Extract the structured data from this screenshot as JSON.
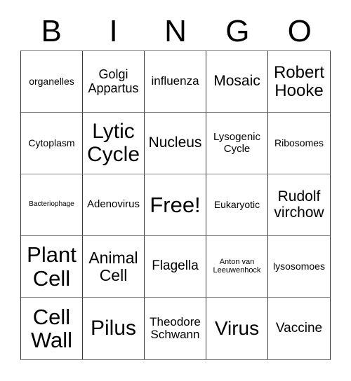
{
  "card": {
    "title": "BINGO",
    "header_letters": [
      "B",
      "I",
      "N",
      "G",
      "O"
    ],
    "grid_size": "5x5",
    "free_space_index": 12,
    "colors": {
      "background": "#ffffff",
      "text": "#000000",
      "grid_line": "#3a3a3a",
      "grid_line_light": "#808080"
    },
    "cells": [
      {
        "text": "organelles",
        "font_size": "14px"
      },
      {
        "text": "Golgi\nAppartus",
        "font_size": "18px"
      },
      {
        "text": "influenza",
        "font_size": "17px"
      },
      {
        "text": "Mosaic",
        "font_size": "21px"
      },
      {
        "text": "Robert\nHooke",
        "font_size": "24px"
      },
      {
        "text": "Cytoplasm",
        "font_size": "14px"
      },
      {
        "text": "Lytic\nCycle",
        "font_size": "30px"
      },
      {
        "text": "Nucleus",
        "font_size": "21px"
      },
      {
        "text": "Lysogenic\nCycle",
        "font_size": "15px"
      },
      {
        "text": "Ribosomes",
        "font_size": "14px"
      },
      {
        "text": "Bacteriophage",
        "font_size": "10px"
      },
      {
        "text": "Adenovirus",
        "font_size": "15px"
      },
      {
        "text": "Free!",
        "font_size": "31px"
      },
      {
        "text": "Eukaryotic",
        "font_size": "14px"
      },
      {
        "text": "Rudolf\nvirchow",
        "font_size": "21px"
      },
      {
        "text": "Plant\nCell",
        "font_size": "31px"
      },
      {
        "text": "Animal\nCell",
        "font_size": "23px"
      },
      {
        "text": "Flagella",
        "font_size": "19px"
      },
      {
        "text": "Anton van\nLeeuwenhock",
        "font_size": "11px"
      },
      {
        "text": "lysosomoes",
        "font_size": "14px"
      },
      {
        "text": "Cell\nWall",
        "font_size": "31px"
      },
      {
        "text": "Pilus",
        "font_size": "30px"
      },
      {
        "text": "Theodore\nSchwann",
        "font_size": "17px"
      },
      {
        "text": "Virus",
        "font_size": "28px"
      },
      {
        "text": "Vaccine",
        "font_size": "19px"
      }
    ]
  }
}
